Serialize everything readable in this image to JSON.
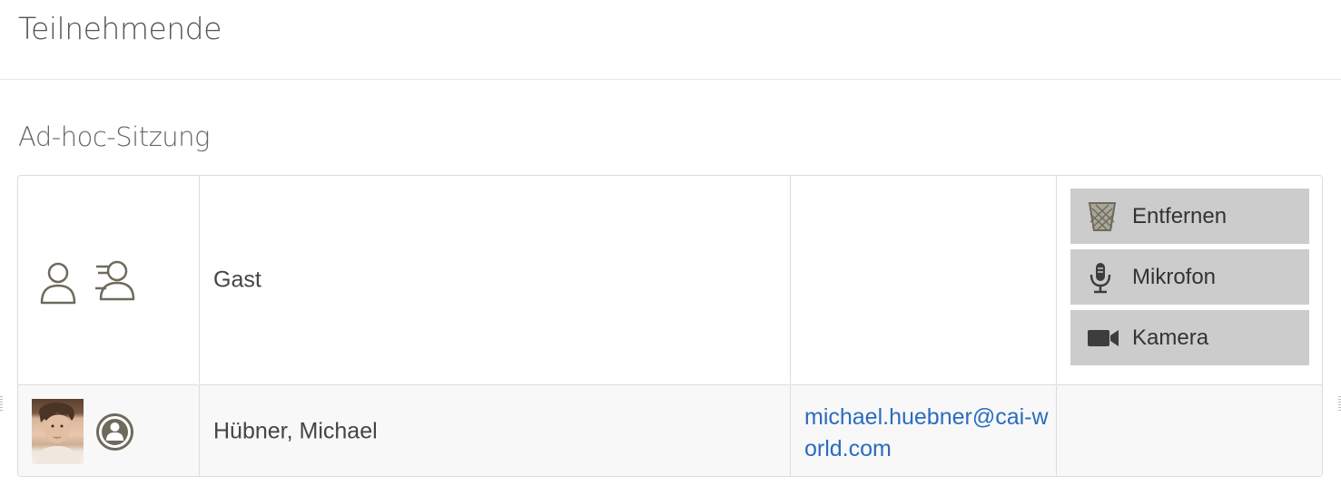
{
  "page": {
    "title": "Teilnehmende"
  },
  "section": {
    "title": "Ad-hoc-Sitzung"
  },
  "participants": [
    {
      "role_icon": "user-outline-icon",
      "status_icon": "fast-user-icon",
      "name": "Gast",
      "email": "",
      "actions": [
        {
          "label": "Entfernen",
          "icon": "trash-icon"
        },
        {
          "label": "Mikrofon",
          "icon": "microphone-icon"
        },
        {
          "label": "Kamera",
          "icon": "camera-icon"
        }
      ]
    },
    {
      "role_icon": "avatar-photo",
      "status_icon": "user-circle-icon",
      "name": "Hübner, Michael",
      "email": "michael.huebner@cai-world.com",
      "actions": []
    }
  ],
  "colors": {
    "link": "#2a6cc0",
    "button_bg": "#cccccc",
    "icon_stroke": "#6e6a5c",
    "row_alt_bg": "#f8f8f8"
  }
}
